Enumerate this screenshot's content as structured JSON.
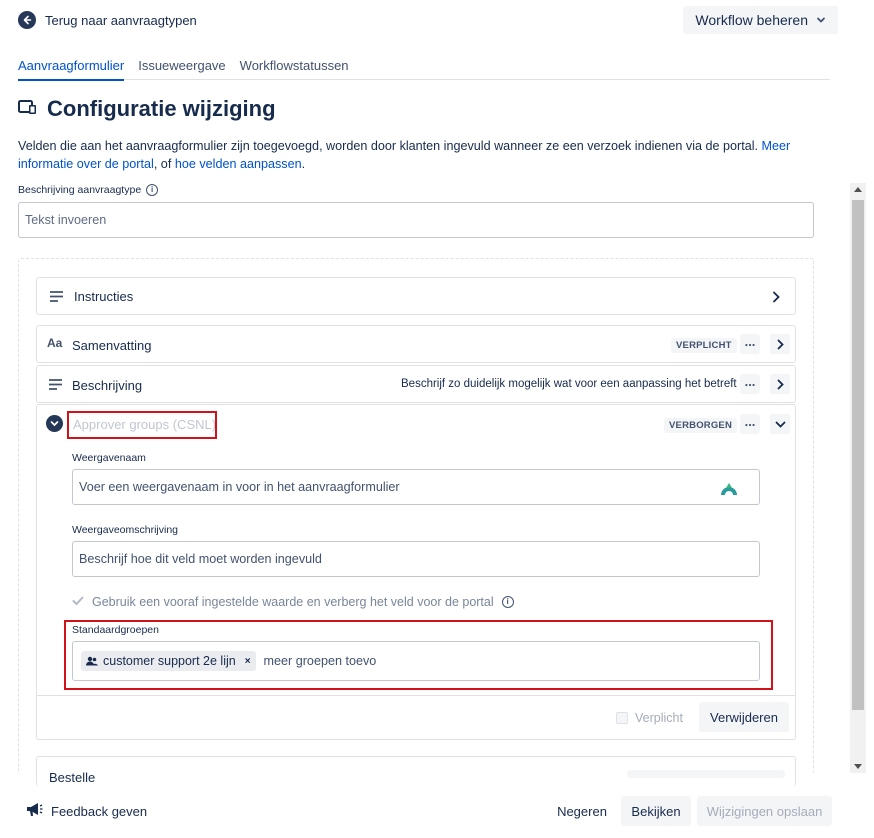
{
  "top": {
    "back_label": "Terug naar aanvraagtypen",
    "workflow_button": "Workflow beheren"
  },
  "tabs": [
    {
      "label": "Aanvraagformulier",
      "active": true
    },
    {
      "label": "Issueweergave",
      "active": false
    },
    {
      "label": "Workflowstatussen",
      "active": false
    }
  ],
  "page": {
    "title": "Configuratie wijziging",
    "description_prefix": "Velden die aan het aanvraagformulier zijn toegevoegd, worden door klanten ingevuld wanneer ze een verzoek indienen via de portal.",
    "description_link1": "Meer informatie over de portal",
    "description_mid": ", of",
    "description_link2": "hoe velden aanpassen",
    "description_end": "."
  },
  "request_type_description": {
    "label": "Beschrijving aanvraagtype",
    "placeholder": "Tekst invoeren"
  },
  "fields": {
    "instructies": {
      "label": "Instructies"
    },
    "samenvatting": {
      "label": "Samenvatting",
      "badge": "VERPLICHT"
    },
    "beschrijving": {
      "label": "Beschrijving",
      "hint": "Beschrijf zo duidelijk mogelijk wat voor een aanpassing het betreft"
    },
    "approver": {
      "label": "Approver groups (CSNL)",
      "badge": "VERBORGEN",
      "display_name_label": "Weergavenaam",
      "display_name_placeholder": "Voer een weergavenaam in voor in het aanvraagformulier",
      "display_desc_label": "Weergaveomschrijving",
      "display_desc_placeholder": "Beschrijf hoe dit veld moet worden ingevuld",
      "preset_checkbox": "Gebruik een vooraf ingestelde waarde en verberg het veld voor de portal",
      "default_groups_label": "Standaardgroepen",
      "group_chip": "customer support 2e lijn",
      "more_groups_placeholder": "meer groepen toevoegen",
      "required_label": "Verplicht",
      "remove_button": "Verwijderen"
    },
    "next_partial": {
      "label": "Bestellen"
    }
  },
  "bottom": {
    "feedback": "Feedback geven",
    "ignore": "Negeren",
    "view": "Bekijken",
    "save": "Wijzigingen opslaan"
  },
  "colors": {
    "link": "#0052cc",
    "highlight_box": "#d0121b",
    "text": "#172b4d"
  }
}
